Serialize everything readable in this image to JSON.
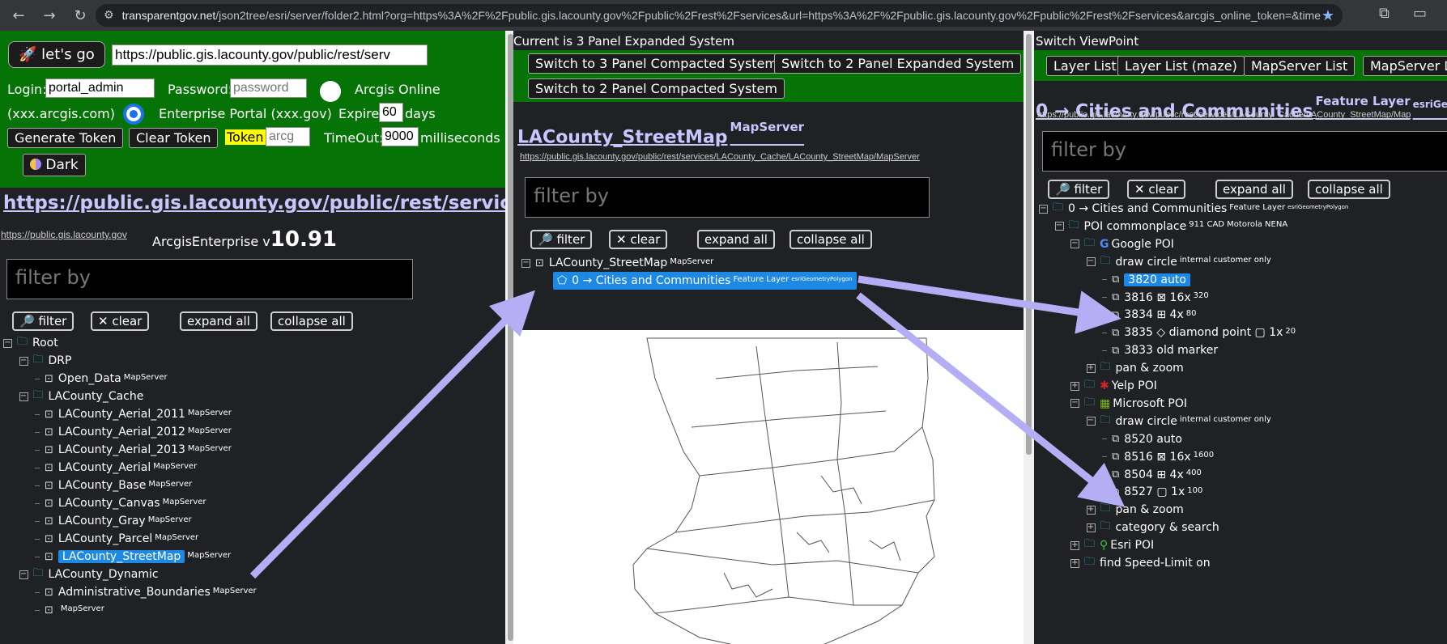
{
  "browser": {
    "url_host": "transparentgov.net",
    "url_rest": "/json2tree/esri/server/folder2.html?org=https%3A%2F%2Fpublic.gis.lacounty.gov%2Fpublic%2Frest%2Fservices&url=https%3A%2F%2Fpublic.gis.lacounty.gov%2Fpublic%2Frest%2Fservices&arcgis_online_token=&timeou..."
  },
  "left": {
    "go_label": "🚀 let's go",
    "url_value": "https://public.gis.lacounty.gov/public/rest/serv",
    "login_label": "Login:",
    "login_value": "portal_admin",
    "password_label": "Password:",
    "password_placeholder": "password",
    "arcgis_online_label": "Arcgis Online",
    "arcgis_com_label": "(xxx.arcgis.com)",
    "enterprise_label": "Enterprise Portal (xxx.gov)",
    "expire_label": "Expire",
    "expire_value": "60",
    "days_label": "days",
    "generate_token": "Generate Token",
    "clear_token": "Clear Token",
    "token_label": "Token",
    "token_placeholder": "arcg",
    "timeout_label": "TimeOut:",
    "timeout_value": "9000",
    "milliseconds_label": "milliseconds",
    "dark_label": "Dark",
    "title": "https://public.gis.lacounty.gov/public/rest/services",
    "host_link": "https://public.gis.lacounty.gov",
    "enterprise_prefix": "ArcgisEnterprise v",
    "version": "10.91",
    "filter_placeholder": "filter by",
    "filter_btn": "🔎 filter",
    "clear_btn": "✕ clear",
    "expand_btn": "expand all",
    "collapse_btn": "collapse all",
    "tree": [
      {
        "label": "Root",
        "kind": "folder",
        "level": 0,
        "exp": "−"
      },
      {
        "label": "DRP",
        "kind": "folder",
        "level": 1,
        "exp": "−"
      },
      {
        "label": "Open_Data",
        "kind": "server",
        "level": 2,
        "sup": "MapServer"
      },
      {
        "label": "LACounty_Cache",
        "kind": "folder",
        "level": 1,
        "exp": "−"
      },
      {
        "label": "LACounty_Aerial_2011",
        "kind": "server",
        "level": 2,
        "sup": "MapServer"
      },
      {
        "label": "LACounty_Aerial_2012",
        "kind": "server",
        "level": 2,
        "sup": "MapServer"
      },
      {
        "label": "LACounty_Aerial_2013",
        "kind": "server",
        "level": 2,
        "sup": "MapServer"
      },
      {
        "label": "LACounty_Aerial",
        "kind": "server",
        "level": 2,
        "sup": "MapServer"
      },
      {
        "label": "LACounty_Base",
        "kind": "server",
        "level": 2,
        "sup": "MapServer"
      },
      {
        "label": "LACounty_Canvas",
        "kind": "server",
        "level": 2,
        "sup": "MapServer"
      },
      {
        "label": "LACounty_Gray",
        "kind": "server",
        "level": 2,
        "sup": "MapServer"
      },
      {
        "label": "LACounty_Parcel",
        "kind": "server",
        "level": 2,
        "sup": "MapServer"
      },
      {
        "label": "LACounty_StreetMap",
        "kind": "server",
        "level": 2,
        "sup": "MapServer",
        "selected": true
      },
      {
        "label": "LACounty_Dynamic",
        "kind": "folder",
        "level": 1,
        "exp": "−"
      },
      {
        "label": "Administrative_Boundaries",
        "kind": "server",
        "level": 2,
        "sup": "MapServer"
      },
      {
        "label": "",
        "kind": "server",
        "level": 2,
        "sup": "MapServer"
      }
    ]
  },
  "mid": {
    "header": "Current is 3 Panel Expanded System",
    "switch1": "Switch to 3 Panel Compacted System",
    "switch2": "Switch to 2 Panel Expanded System",
    "switch3": "Switch to 2 Panel Compacted System",
    "title": "LACounty_StreetMap",
    "title_sup": "MapServer",
    "link": "https://public.gis.lacounty.gov/public/rest/services/LACounty_Cache/LACounty_StreetMap/MapServer",
    "filter_placeholder": "filter by",
    "filter_btn": "🔎 filter",
    "clear_btn": "✕ clear",
    "expand_btn": "expand all",
    "collapse_btn": "collapse all",
    "root_label": "LACounty_StreetMap",
    "root_sup": "MapServer",
    "layer_label": "0 → Cities and Communities",
    "layer_sup": "Feature Layer",
    "layer_sup2": "esriGeometryPolygon"
  },
  "right": {
    "header": "Switch ViewPoint",
    "btn1": "Layer List",
    "btn2": "Layer List (maze)",
    "btn3": "MapServer List",
    "btn4": "MapServer L",
    "title": "0 → Cities and Communities",
    "title_sup": "Feature Layer",
    "title_sup2": "esriGeomet",
    "link": "https://public.gis.lacounty.gov/public/rest/services/LACounty_Cache/LACounty_StreetMap/Map",
    "filter_placeholder": "filter by",
    "filter_btn": "🔎 filter",
    "clear_btn": "✕ clear",
    "expand_btn": "expand all",
    "collapse_btn": "collapse all",
    "tree": [
      {
        "label": "0 → Cities and Communities",
        "kind": "folder",
        "level": 0,
        "exp": "−",
        "sup": "Feature Layer",
        "sup2": "esriGeometryPolygon"
      },
      {
        "label": "POI commonplace",
        "kind": "folder",
        "level": 1,
        "exp": "−",
        "sup": "911 CAD Motorola NENA"
      },
      {
        "label": "Google POI",
        "kind": "folder",
        "level": 2,
        "exp": "−",
        "badge": "G",
        "badge_color": "#4a8af4"
      },
      {
        "label": "draw circle",
        "kind": "folder",
        "level": 3,
        "exp": "−",
        "sup": "internal customer only"
      },
      {
        "label": "3820 auto",
        "kind": "link",
        "level": 4,
        "selected": true
      },
      {
        "label": "3816 ⊠ 16x",
        "kind": "link",
        "level": 4,
        "sup": "320"
      },
      {
        "label": "3834 ⊞ 4x",
        "kind": "link",
        "level": 4,
        "sup": "80"
      },
      {
        "label": "3835 ◇ diamond point ▢ 1x",
        "kind": "link",
        "level": 4,
        "sup": "20"
      },
      {
        "label": "3833 old marker",
        "kind": "link",
        "level": 4
      },
      {
        "label": "pan & zoom",
        "kind": "folder",
        "level": 3,
        "exp": "+"
      },
      {
        "label": "Yelp POI",
        "kind": "folder",
        "level": 2,
        "exp": "+",
        "badge": "✱",
        "badge_color": "#d32323"
      },
      {
        "label": "Microsoft POI",
        "kind": "folder",
        "level": 2,
        "exp": "−",
        "badge": "▦",
        "badge_color": "#7fba00"
      },
      {
        "label": "draw circle",
        "kind": "folder",
        "level": 3,
        "exp": "−",
        "sup": "internal customer only"
      },
      {
        "label": "8520 auto",
        "kind": "link",
        "level": 4
      },
      {
        "label": "8516 ⊠ 16x",
        "kind": "link",
        "level": 4,
        "sup": "1600"
      },
      {
        "label": "8504 ⊞ 4x",
        "kind": "link",
        "level": 4,
        "sup": "400"
      },
      {
        "label": "8527 ▢ 1x",
        "kind": "link",
        "level": 4,
        "sup": "100"
      },
      {
        "label": "pan & zoom",
        "kind": "folder",
        "level": 3,
        "exp": "+"
      },
      {
        "label": "category & search",
        "kind": "folder",
        "level": 3,
        "exp": "+"
      },
      {
        "label": "Esri POI",
        "kind": "folder",
        "level": 2,
        "exp": "+",
        "badge": "⚲",
        "badge_color": "#3fbf3f"
      },
      {
        "label": "find Speed-Limit on",
        "kind": "folder",
        "level": 2,
        "exp": "+"
      }
    ]
  },
  "colors": {
    "green": "#067306",
    "accent": "#c8c6ff",
    "selected": "#1e88e5",
    "arrow": "#b5aef5"
  }
}
